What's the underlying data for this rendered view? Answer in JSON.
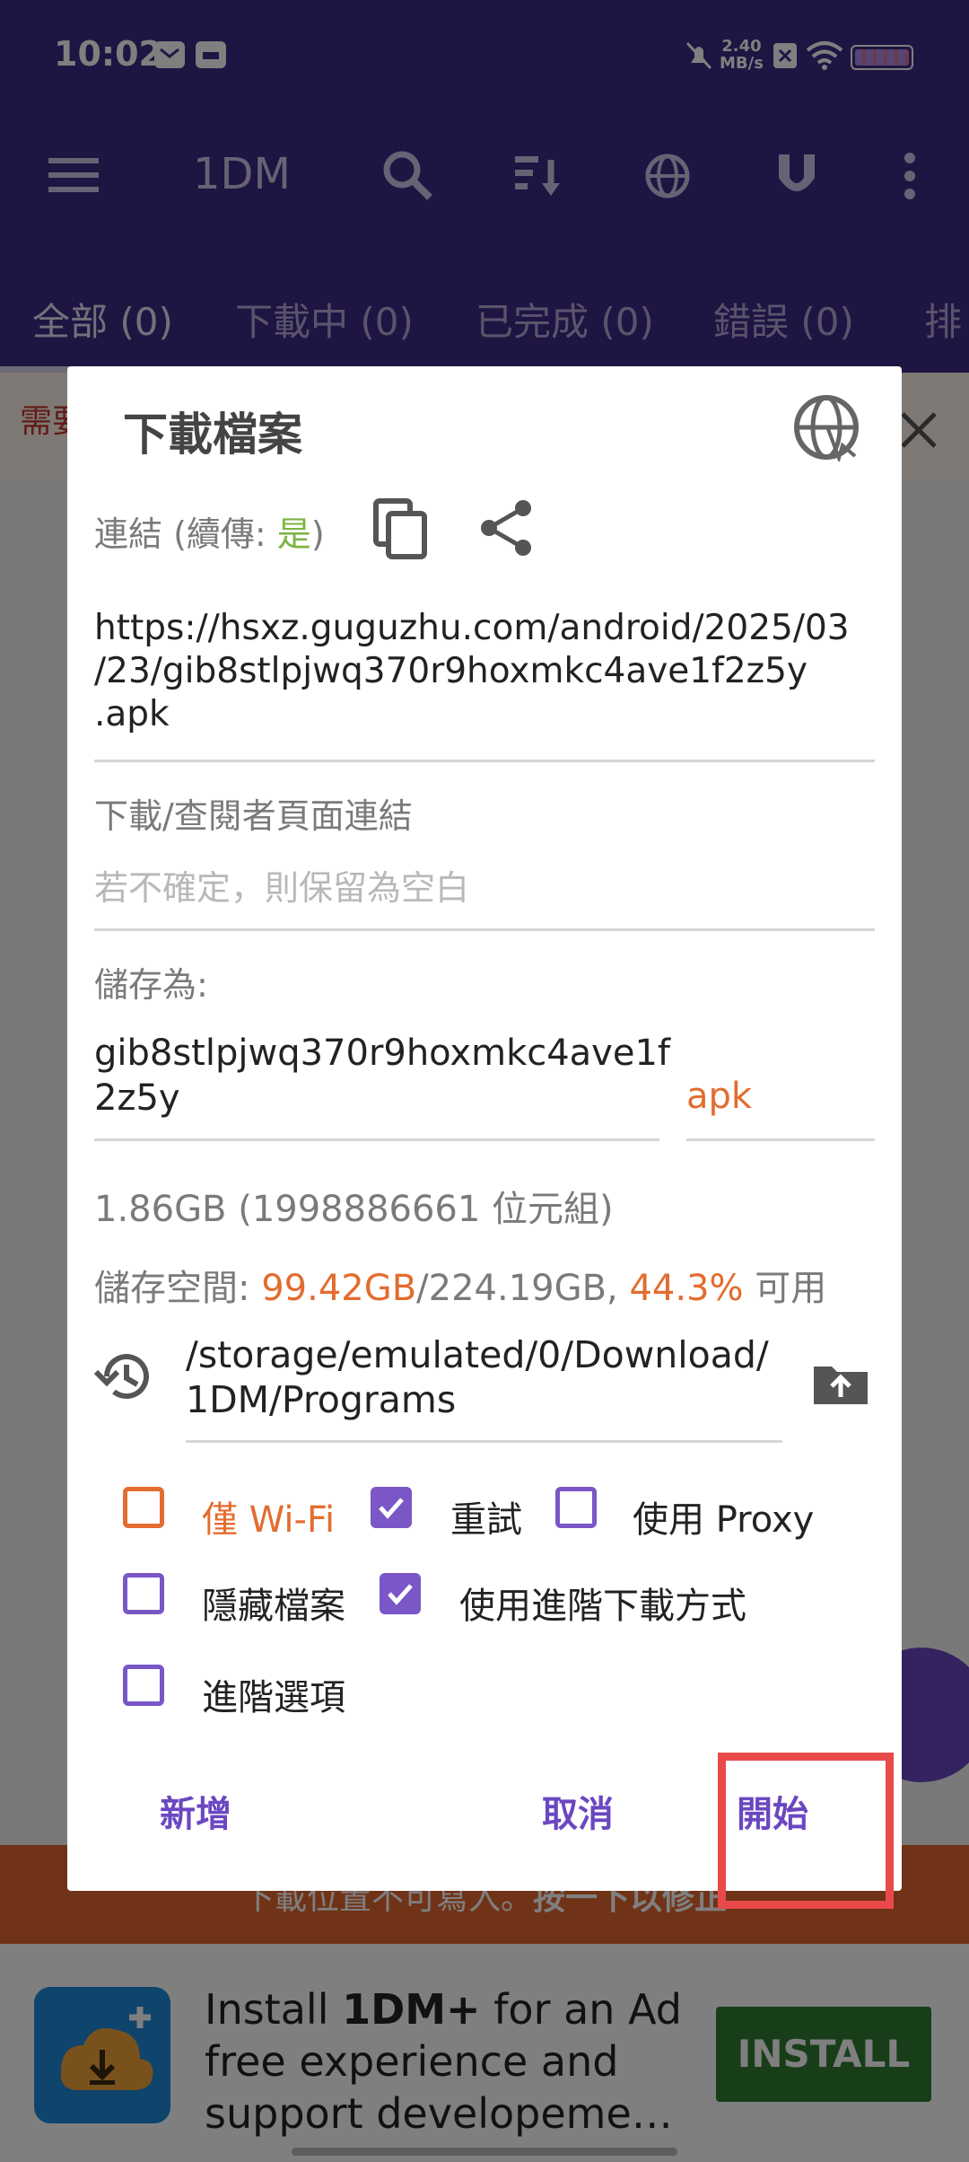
{
  "status_bar": {
    "time": "10:02",
    "speed_value": "2.40",
    "speed_unit": "MB/s"
  },
  "app_bar": {
    "title": "1DM"
  },
  "tabs": [
    {
      "label": "全部 (0)"
    },
    {
      "label": "下載中 (0)"
    },
    {
      "label": "已完成 (0)"
    },
    {
      "label": "錯誤 (0)"
    },
    {
      "label": "排"
    }
  ],
  "background": {
    "left_hint": "需要",
    "warning_text": "下載位置不可寫入。",
    "warning_bold": "按一下以修正"
  },
  "ad": {
    "line1_pre": "Install ",
    "line1_bold": "1DM+",
    "line1_post": " for an Ad",
    "line2": "free experience and",
    "line3": "support developeme…",
    "install_label": "INSTALL"
  },
  "dialog": {
    "title": "下載檔案",
    "link_label_pre": "連結 (續傳: ",
    "link_label_yes": "是",
    "link_label_post": ")",
    "url_line1": "https://hsxz.guguzhu.com/android/2025/03",
    "url_line2": "/23/gib8stlpjwq370r9hoxmkc4ave1f2z5y",
    "url_line3": ".apk",
    "referer_label": "下載/查閱者頁面連結",
    "referer_placeholder": "若不確定，則保留為空白",
    "save_as_label": "儲存為:",
    "filename_line1": "gib8stlpjwq370r9hoxmkc4ave1f",
    "filename_line2": "2z5y",
    "extension": "apk",
    "size_text": "1.86GB (1998886661 位元組)",
    "storage_label": "儲存空間: ",
    "storage_free": "99.42GB",
    "storage_total": "/224.19GB, ",
    "storage_percent": "44.3%",
    "storage_suffix": " 可用",
    "path_line1": "/storage/emulated/0/Download/",
    "path_line2": "1DM/Programs",
    "options": {
      "wifi_only": {
        "label": "僅 Wi-Fi",
        "checked": false
      },
      "retry": {
        "label": "重試",
        "checked": true
      },
      "use_proxy": {
        "label": "使用 Proxy",
        "checked": false
      },
      "hide_file": {
        "label": "隱藏檔案",
        "checked": false
      },
      "advanced_method": {
        "label": "使用進階下載方式",
        "checked": true
      },
      "advanced_options": {
        "label": "進階選項",
        "checked": false
      }
    },
    "add_button": "新增",
    "cancel_button": "取消",
    "start_button": "開始"
  },
  "colors": {
    "primary": "#3f2a86",
    "accent": "#7a56c6",
    "orange": "#e36c2f",
    "green": "#2e7d32",
    "highlight_box": "#e84a4a"
  }
}
